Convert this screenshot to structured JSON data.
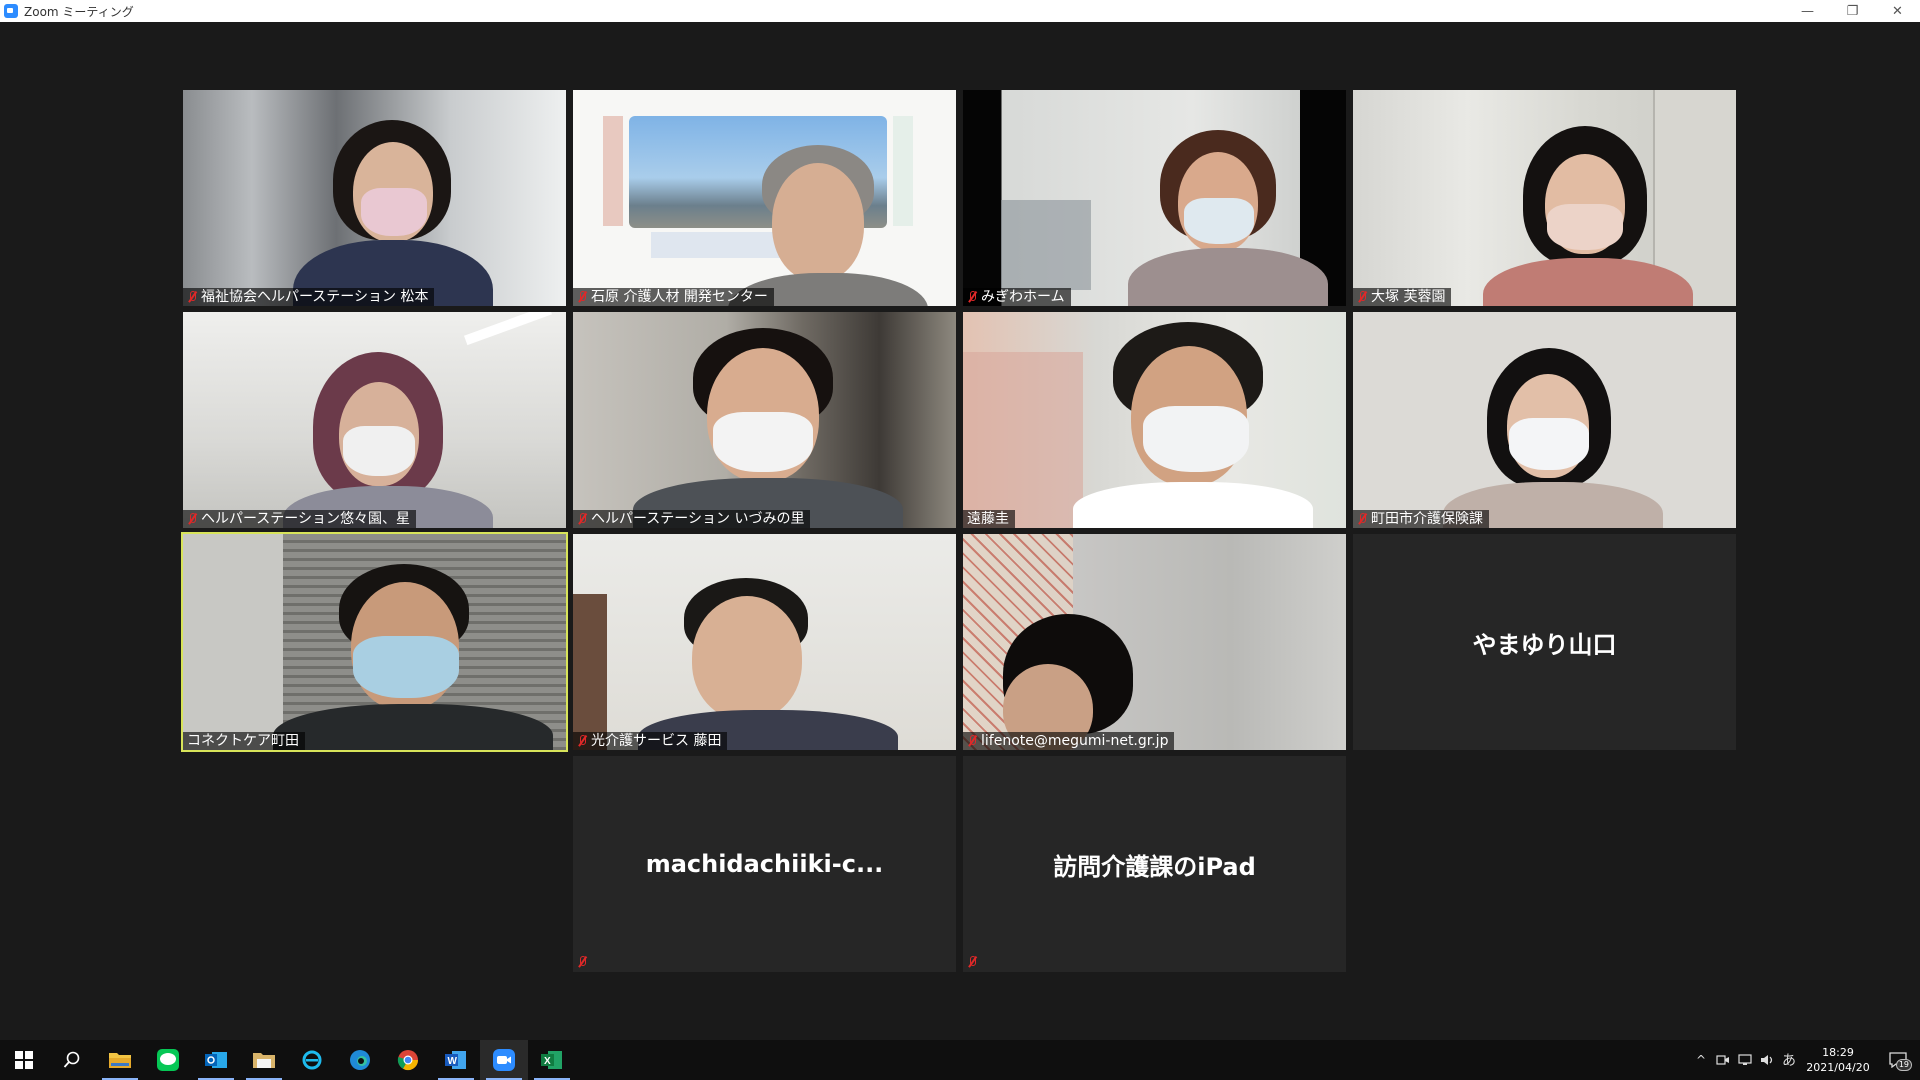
{
  "window": {
    "title": "Zoom ミーティング",
    "minimize_glyph": "—",
    "restore_glyph": "❐",
    "close_glyph": "✕"
  },
  "participants": [
    {
      "name": "福祉協会ヘルパーステーション  松本",
      "muted": true
    },
    {
      "name": "石原  介護人材 開発センター",
      "muted": true
    },
    {
      "name": "みぎわホーム",
      "muted": true
    },
    {
      "name": "大塚  芙蓉園",
      "muted": true
    },
    {
      "name": "ヘルパーステーション悠々園、星",
      "muted": true
    },
    {
      "name": "ヘルパーステーション いづみの里",
      "muted": true
    },
    {
      "name": "遠藤圭",
      "muted": false
    },
    {
      "name": "町田市介護保険課",
      "muted": true
    },
    {
      "name": "コネクトケア町田",
      "muted": false,
      "active_speaker": true
    },
    {
      "name": "光介護サービス  藤田",
      "muted": true
    },
    {
      "name": "lifenote@megumi-net.gr.jp",
      "muted": true
    },
    {
      "name": "やまゆり山口",
      "muted": false,
      "video_off": true
    },
    {
      "name": "machidachiiki-c...",
      "muted": true,
      "video_off": true
    },
    {
      "name": "訪問介護課のiPad",
      "muted": true,
      "video_off": true
    }
  ],
  "taskbar": {
    "apps": [
      "windows-start",
      "search",
      "file-explorer",
      "line",
      "outlook",
      "file-manager",
      "internet-explorer",
      "edge",
      "chrome",
      "word",
      "zoom",
      "excel"
    ],
    "tray": {
      "caret": "^",
      "ime": "あ",
      "time": "18:29",
      "date": "2021/04/20",
      "notification_count": "19"
    }
  },
  "colors": {
    "background": "#1a1a1a",
    "active_speaker_border": "#d8e45a",
    "muted_icon": "#e02828",
    "video_off_tile": "#262626"
  }
}
